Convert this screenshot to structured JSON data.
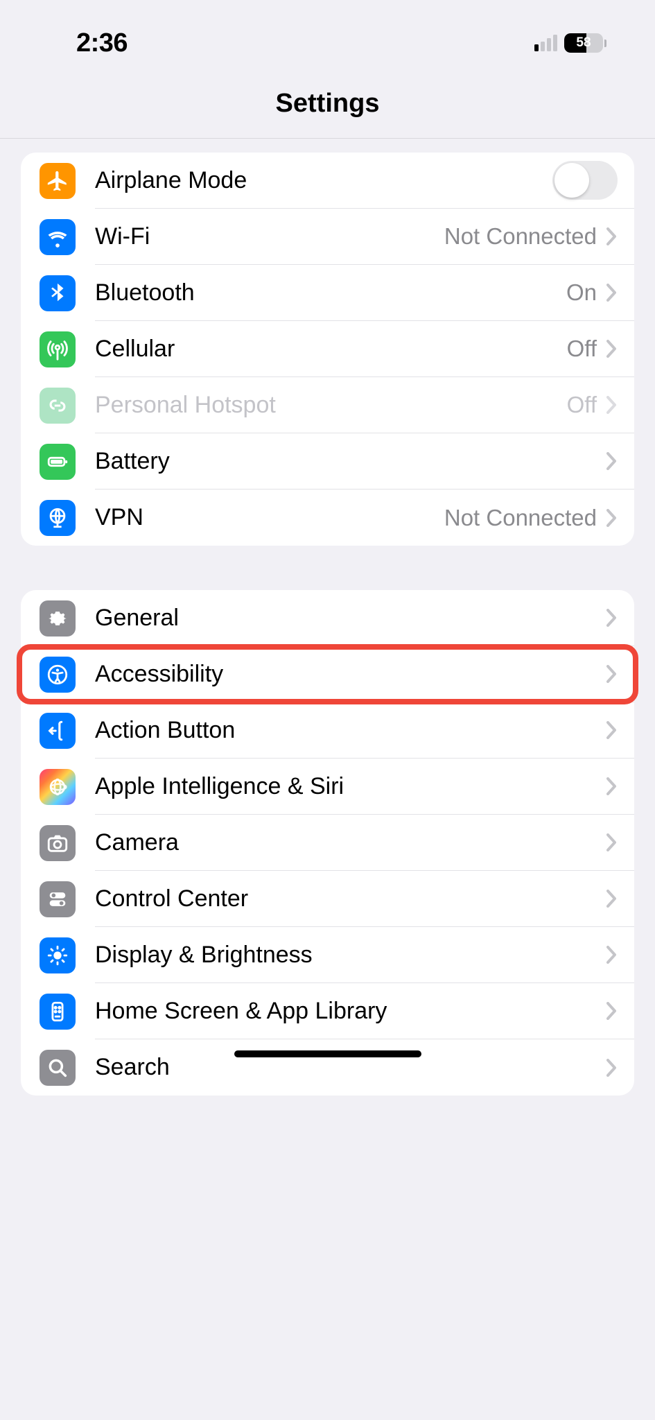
{
  "status": {
    "time": "2:36",
    "battery": "58"
  },
  "page": {
    "title": "Settings"
  },
  "group1": {
    "items": [
      {
        "label": "Airplane Mode",
        "value": "",
        "icon": "airplane",
        "type": "toggle",
        "on": false
      },
      {
        "label": "Wi-Fi",
        "value": "Not Connected",
        "icon": "wifi",
        "type": "link"
      },
      {
        "label": "Bluetooth",
        "value": "On",
        "icon": "bluetooth",
        "type": "link"
      },
      {
        "label": "Cellular",
        "value": "Off",
        "icon": "cellular",
        "type": "link"
      },
      {
        "label": "Personal Hotspot",
        "value": "Off",
        "icon": "hotspot",
        "type": "link",
        "disabled": true
      },
      {
        "label": "Battery",
        "value": "",
        "icon": "battery",
        "type": "link"
      },
      {
        "label": "VPN",
        "value": "Not Connected",
        "icon": "vpn",
        "type": "link"
      }
    ]
  },
  "group2": {
    "items": [
      {
        "label": "General",
        "icon": "general",
        "type": "link"
      },
      {
        "label": "Accessibility",
        "icon": "accessibility",
        "type": "link",
        "highlight": true
      },
      {
        "label": "Action Button",
        "icon": "actionbutton",
        "type": "link"
      },
      {
        "label": "Apple Intelligence & Siri",
        "icon": "siri",
        "type": "link"
      },
      {
        "label": "Camera",
        "icon": "camera",
        "type": "link"
      },
      {
        "label": "Control Center",
        "icon": "controlcenter",
        "type": "link"
      },
      {
        "label": "Display & Brightness",
        "icon": "display",
        "type": "link"
      },
      {
        "label": "Home Screen & App Library",
        "icon": "homescreen",
        "type": "link"
      },
      {
        "label": "Search",
        "icon": "search",
        "type": "link"
      }
    ]
  }
}
